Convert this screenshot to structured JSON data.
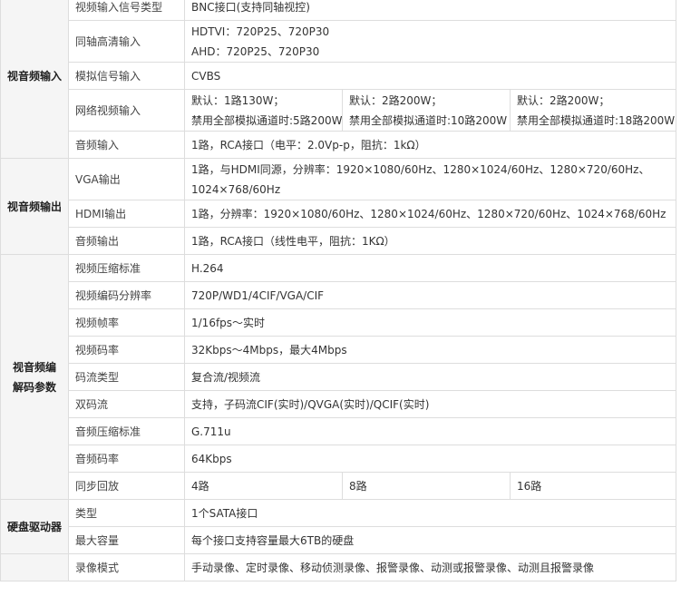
{
  "groups": [
    {
      "category": "视音频输入",
      "rows": [
        {
          "label": "视频输入信号类型",
          "values": [
            "BNC接口(支持同轴视控)"
          ]
        },
        {
          "label": "同轴高清输入",
          "values": [
            [
              "HDTVI：720P25、720P30",
              "AHD：720P25、720P30"
            ]
          ]
        },
        {
          "label": "模拟信号输入",
          "values": [
            "CVBS"
          ]
        },
        {
          "label": "网络视频输入",
          "values": [
            [
              "默认：1路130W；",
              "禁用全部模拟通道时:5路200W"
            ],
            [
              "默认：2路200W；",
              "禁用全部模拟通道时:10路200W"
            ],
            [
              "默认：2路200W；",
              "禁用全部模拟通道时:18路200W"
            ]
          ]
        },
        {
          "label": "音频输入",
          "values": [
            "1路，RCA接口（电平：2.0Vp-p，阻抗：1kΩ）"
          ]
        }
      ]
    },
    {
      "category": "视音频输出",
      "rows": [
        {
          "label": "VGA输出",
          "values": [
            [
              "1路，与HDMI同源，分辨率：1920×1080/60Hz、1280×1024/60Hz、1280×720/60Hz、",
              "1024×768/60Hz"
            ]
          ]
        },
        {
          "label": "HDMI输出",
          "values": [
            "1路，分辨率：1920×1080/60Hz、1280×1024/60Hz、1280×720/60Hz、1024×768/60Hz"
          ]
        },
        {
          "label": "音频输出",
          "values": [
            "1路，RCA接口（线性电平，阻抗：1KΩ）"
          ]
        }
      ]
    },
    {
      "category": "视音频编解码参数",
      "rows": [
        {
          "label": "视频压缩标准",
          "values": [
            "H.264"
          ]
        },
        {
          "label": "视频编码分辨率",
          "values": [
            "720P/WD1/4CIF/VGA/CIF"
          ]
        },
        {
          "label": "视频帧率",
          "values": [
            "1/16fps～实时"
          ]
        },
        {
          "label": "视频码率",
          "values": [
            "32Kbps～4Mbps，最大4Mbps"
          ]
        },
        {
          "label": "码流类型",
          "values": [
            "复合流/视频流"
          ]
        },
        {
          "label": "双码流",
          "values": [
            "支持，子码流CIF(实时)/QVGA(实时)/QCIF(实时)"
          ]
        },
        {
          "label": "音频压缩标准",
          "values": [
            "G.711u"
          ]
        },
        {
          "label": "音频码率",
          "values": [
            "64Kbps"
          ]
        },
        {
          "label": "同步回放",
          "values": [
            "4路",
            "8路",
            "16路"
          ]
        }
      ]
    },
    {
      "category": "硬盘驱动器",
      "rows": [
        {
          "label": "类型",
          "values": [
            "1个SATA接口"
          ]
        },
        {
          "label": "最大容量",
          "values": [
            "每个接口支持容量最大6TB的硬盘"
          ]
        }
      ]
    },
    {
      "category": "",
      "rows": [
        {
          "label": "录像模式",
          "values": [
            "手动录像、定时录像、移动侦测录像、报警录像、动测或报警录像、动测且报警录像"
          ]
        }
      ]
    }
  ]
}
